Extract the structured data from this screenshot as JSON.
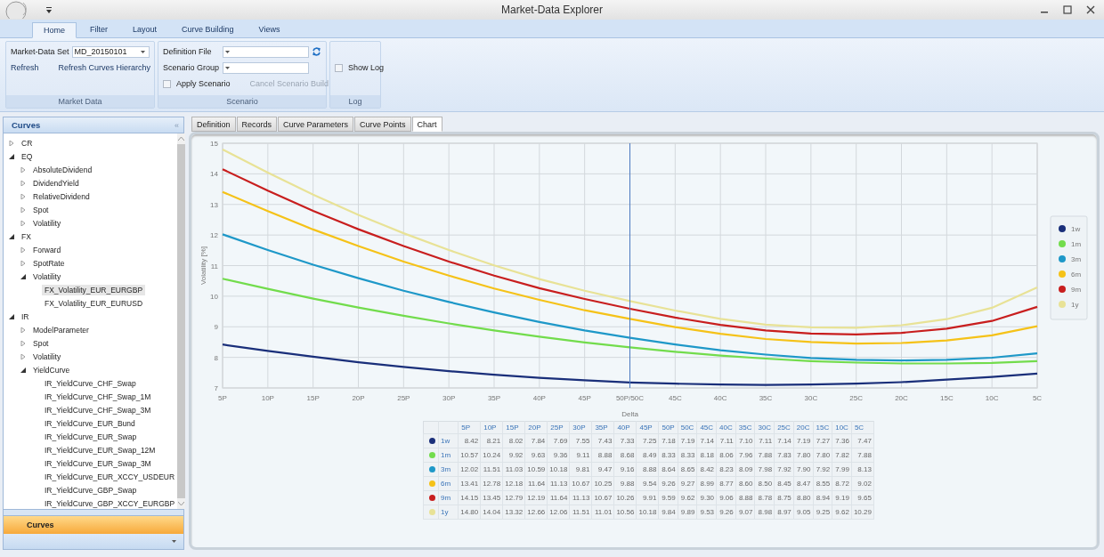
{
  "window": {
    "title": "Market-Data Explorer"
  },
  "ribbon": {
    "tabs": [
      {
        "label": "Home",
        "selected": true
      },
      {
        "label": "Filter",
        "selected": false
      },
      {
        "label": "Layout",
        "selected": false
      },
      {
        "label": "Curve Building",
        "selected": false
      },
      {
        "label": "Views",
        "selected": false
      }
    ],
    "market_data": {
      "title": "Market Data",
      "set_label": "Market-Data Set",
      "set_value": "MD_20150101",
      "refresh": "Refresh",
      "refresh_hierarchy": "Refresh Curves Hierarchy"
    },
    "scenario": {
      "title": "Scenario",
      "definition_label": "Definition File",
      "group_label": "Scenario Group",
      "apply_label": "Apply Scenario",
      "apply_checked": false,
      "cancel_label": "Cancel Scenario Build",
      "cancel_disabled": true
    },
    "log": {
      "title": "Log",
      "show_label": "Show Log",
      "show_checked": false
    }
  },
  "sidebar": {
    "title": "Curves",
    "collapse": "«",
    "tree": [
      {
        "label": "CR",
        "expanded": false,
        "selected": false
      },
      {
        "label": "EQ",
        "expanded": true,
        "selected": false,
        "children": [
          {
            "label": "AbsoluteDividend",
            "expanded": false,
            "selected": false
          },
          {
            "label": "DividendYield",
            "expanded": false,
            "selected": false
          },
          {
            "label": "RelativeDividend",
            "expanded": false,
            "selected": false
          },
          {
            "label": "Spot",
            "expanded": false,
            "selected": false
          },
          {
            "label": "Volatility",
            "expanded": false,
            "selected": false
          }
        ]
      },
      {
        "label": "FX",
        "expanded": true,
        "selected": false,
        "children": [
          {
            "label": "Forward",
            "expanded": false,
            "selected": false
          },
          {
            "label": "SpotRate",
            "expanded": false,
            "selected": false
          },
          {
            "label": "Volatility",
            "expanded": true,
            "selected": false,
            "children": [
              {
                "label": "FX_Volatility_EUR_EURGBP",
                "selected": true
              },
              {
                "label": "FX_Volatility_EUR_EURUSD",
                "selected": false
              }
            ]
          }
        ]
      },
      {
        "label": "IR",
        "expanded": true,
        "selected": false,
        "children": [
          {
            "label": "ModelParameter",
            "expanded": false,
            "selected": false
          },
          {
            "label": "Spot",
            "expanded": false,
            "selected": false
          },
          {
            "label": "Volatility",
            "expanded": false,
            "selected": false
          },
          {
            "label": "YieldCurve",
            "expanded": true,
            "selected": false,
            "children": [
              {
                "label": "IR_YieldCurve_CHF_Swap",
                "selected": false
              },
              {
                "label": "IR_YieldCurve_CHF_Swap_1M",
                "selected": false
              },
              {
                "label": "IR_YieldCurve_CHF_Swap_3M",
                "selected": false
              },
              {
                "label": "IR_YieldCurve_EUR_Bund",
                "selected": false
              },
              {
                "label": "IR_YieldCurve_EUR_Swap",
                "selected": false
              },
              {
                "label": "IR_YieldCurve_EUR_Swap_12M",
                "selected": false
              },
              {
                "label": "IR_YieldCurve_EUR_Swap_3M",
                "selected": false
              },
              {
                "label": "IR_YieldCurve_EUR_XCCY_USDEUR",
                "selected": false
              },
              {
                "label": "IR_YieldCurve_GBP_Swap",
                "selected": false
              },
              {
                "label": "IR_YieldCurve_GBP_XCCY_EURGBP",
                "selected": false
              }
            ]
          }
        ]
      }
    ],
    "bottom_button": "Curves"
  },
  "content_tabs": [
    {
      "label": "Definition",
      "selected": false
    },
    {
      "label": "Records",
      "selected": false
    },
    {
      "label": "Curve Parameters",
      "selected": false
    },
    {
      "label": "Curve Points",
      "selected": false
    },
    {
      "label": "Chart",
      "selected": true
    }
  ],
  "chart": {
    "chart_data": {
      "type": "line",
      "xlabel": "Delta",
      "ylabel": "Volatility [%]",
      "categories": [
        "5P",
        "10P",
        "15P",
        "20P",
        "25P",
        "30P",
        "35P",
        "40P",
        "45P",
        "50P/50C",
        "45C",
        "40C",
        "35C",
        "30C",
        "25C",
        "20C",
        "15C",
        "10C",
        "5C"
      ],
      "ylim": [
        7,
        15
      ],
      "grid": true,
      "legend": true,
      "ref_lines": [
        {
          "axis": "x",
          "value": "50P/50C",
          "color": "#4a78c0"
        }
      ],
      "yticks": [
        7,
        8,
        9,
        10,
        11,
        12,
        13,
        14,
        15
      ],
      "series": [
        {
          "name": "1w",
          "color": "#1a2f7a",
          "values": [
            8.42,
            8.21,
            8.02,
            7.84,
            7.69,
            7.55,
            7.43,
            7.33,
            7.25,
            7.18,
            7.14,
            7.11,
            7.1,
            7.11,
            7.14,
            7.19,
            7.27,
            7.36,
            7.47
          ]
        },
        {
          "name": "1m",
          "color": "#72dc4c",
          "values": [
            10.57,
            10.24,
            9.92,
            9.63,
            9.36,
            9.11,
            8.88,
            8.68,
            8.49,
            8.33,
            8.18,
            8.06,
            7.96,
            7.88,
            7.83,
            7.8,
            7.8,
            7.82,
            7.88
          ]
        },
        {
          "name": "3m",
          "color": "#1e98c8",
          "values": [
            12.02,
            11.51,
            11.03,
            10.59,
            10.18,
            9.81,
            9.47,
            9.16,
            8.88,
            8.64,
            8.42,
            8.23,
            8.09,
            7.98,
            7.92,
            7.9,
            7.92,
            7.99,
            8.13
          ]
        },
        {
          "name": "6m",
          "color": "#f5c218",
          "values": [
            13.41,
            12.78,
            12.18,
            11.64,
            11.13,
            10.67,
            10.25,
            9.88,
            9.54,
            9.26,
            8.99,
            8.77,
            8.6,
            8.5,
            8.45,
            8.47,
            8.55,
            8.72,
            9.02
          ]
        },
        {
          "name": "9m",
          "color": "#c81e1e",
          "values": [
            14.15,
            13.45,
            12.79,
            12.19,
            11.64,
            11.13,
            10.67,
            10.26,
            9.91,
            9.59,
            9.3,
            9.06,
            8.88,
            8.78,
            8.75,
            8.8,
            8.94,
            9.19,
            9.65
          ]
        },
        {
          "name": "1y",
          "color": "#e8e296",
          "values": [
            14.8,
            14.04,
            13.32,
            12.66,
            12.06,
            11.51,
            11.01,
            10.56,
            10.18,
            9.84,
            9.53,
            9.26,
            9.07,
            8.98,
            8.97,
            9.05,
            9.25,
            9.62,
            10.29
          ]
        }
      ]
    }
  },
  "table": {
    "columns": [
      "5P",
      "10P",
      "15P",
      "20P",
      "25P",
      "30P",
      "35P",
      "40P",
      "45P",
      "50P",
      "50C",
      "45C",
      "40C",
      "35C",
      "30C",
      "25C",
      "20C",
      "15C",
      "10C",
      "5C"
    ],
    "rows": [
      {
        "label": "1w",
        "color": "#1a2f7a",
        "values": [
          "8.42",
          "8.21",
          "8.02",
          "7.84",
          "7.69",
          "7.55",
          "7.43",
          "7.33",
          "7.25",
          "7.18",
          "7.19",
          "7.14",
          "7.11",
          "7.10",
          "7.11",
          "7.14",
          "7.19",
          "7.27",
          "7.36",
          "7.47"
        ]
      },
      {
        "label": "1m",
        "color": "#72dc4c",
        "values": [
          "10.57",
          "10.24",
          "9.92",
          "9.63",
          "9.36",
          "9.11",
          "8.88",
          "8.68",
          "8.49",
          "8.33",
          "8.33",
          "8.18",
          "8.06",
          "7.96",
          "7.88",
          "7.83",
          "7.80",
          "7.80",
          "7.82",
          "7.88"
        ]
      },
      {
        "label": "3m",
        "color": "#1e98c8",
        "values": [
          "12.02",
          "11.51",
          "11.03",
          "10.59",
          "10.18",
          "9.81",
          "9.47",
          "9.16",
          "8.88",
          "8.64",
          "8.65",
          "8.42",
          "8.23",
          "8.09",
          "7.98",
          "7.92",
          "7.90",
          "7.92",
          "7.99",
          "8.13"
        ]
      },
      {
        "label": "6m",
        "color": "#f5c218",
        "values": [
          "13.41",
          "12.78",
          "12.18",
          "11.64",
          "11.13",
          "10.67",
          "10.25",
          "9.88",
          "9.54",
          "9.26",
          "9.27",
          "8.99",
          "8.77",
          "8.60",
          "8.50",
          "8.45",
          "8.47",
          "8.55",
          "8.72",
          "9.02"
        ]
      },
      {
        "label": "9m",
        "color": "#c81e1e",
        "values": [
          "14.15",
          "13.45",
          "12.79",
          "12.19",
          "11.64",
          "11.13",
          "10.67",
          "10.26",
          "9.91",
          "9.59",
          "9.62",
          "9.30",
          "9.06",
          "8.88",
          "8.78",
          "8.75",
          "8.80",
          "8.94",
          "9.19",
          "9.65"
        ]
      },
      {
        "label": "1y",
        "color": "#e8e296",
        "values": [
          "14.80",
          "14.04",
          "13.32",
          "12.66",
          "12.06",
          "11.51",
          "11.01",
          "10.56",
          "10.18",
          "9.84",
          "9.89",
          "9.53",
          "9.26",
          "9.07",
          "8.98",
          "8.97",
          "9.05",
          "9.25",
          "9.62",
          "10.29"
        ]
      }
    ]
  }
}
